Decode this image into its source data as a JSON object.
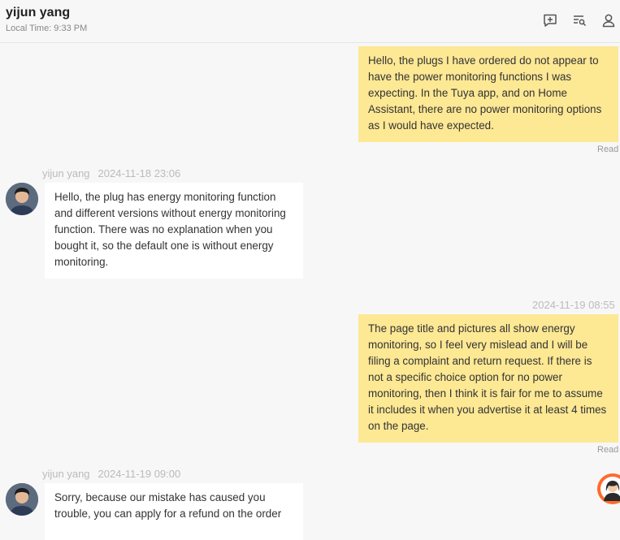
{
  "header": {
    "contact_name": "yijun yang",
    "local_time": "Local Time: 9:33 PM",
    "icons": [
      "add-comment-icon",
      "search-list-icon",
      "profile-icon"
    ]
  },
  "messages": [
    {
      "direction": "outgoing",
      "text": "Hello, the plugs I have ordered do not appear to have the power monitoring functions I was expecting. In the Tuya app, and on Home Assistant, there are no power monitoring options as I would have expected.",
      "status": "Read"
    },
    {
      "direction": "incoming",
      "sender": "yijun yang",
      "time": "2024-11-18 23:06",
      "text": "Hello, the plug has energy monitoring function and different versions without energy monitoring function. There was no explanation when you bought it, so the default one is without energy monitoring."
    },
    {
      "direction": "outgoing",
      "time": "2024-11-19 08:55",
      "text": "The page title and pictures all show energy monitoring, so I feel very mislead and I will be filing a complaint and return request. If there is not a specific choice option for no power monitoring, then I think it is fair for me to assume it includes it when you advertise it at least 4 times on the page.",
      "status": "Read"
    },
    {
      "direction": "incoming",
      "sender": "yijun yang",
      "time": "2024-11-19 09:00",
      "text": "Sorry, because our mistake has caused you trouble, you can apply for a refund on the order"
    }
  ],
  "colors": {
    "outgoing_bubble": "#fde894",
    "incoming_bubble": "#ffffff",
    "background": "#f7f7f7",
    "agent_button": "#ff6a2b"
  }
}
